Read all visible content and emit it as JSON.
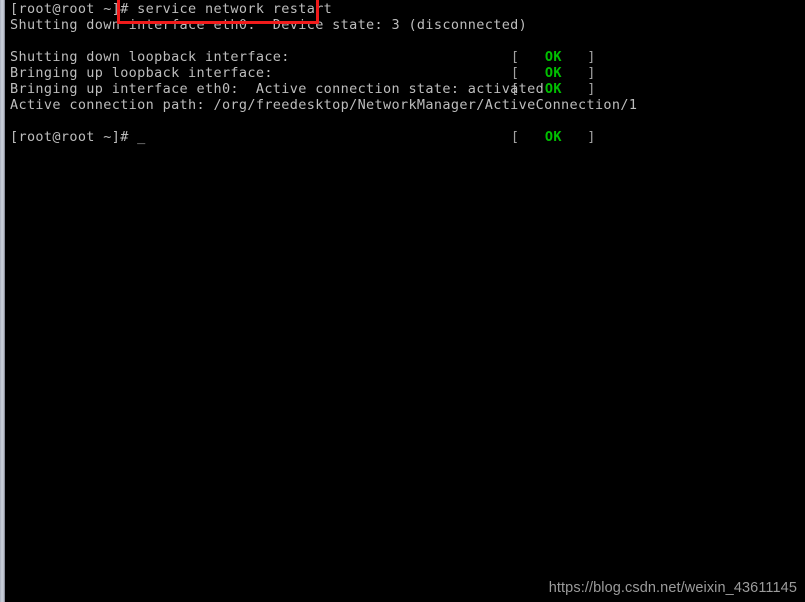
{
  "window": {
    "title": "terminal",
    "background_color": "#000000",
    "foreground_color": "#bdbdbd",
    "ok_color": "#00c000",
    "annotation_color": "#f01b1b"
  },
  "terminal": {
    "prompt": "[root@root ~]#",
    "command": "service network restart",
    "lines": [
      {
        "id": "line-1-prompt",
        "text": "[root@root ~]# service network restart"
      },
      {
        "id": "line-2-shutdown-eth0",
        "text": "Shutting down interface eth0:  Device state: 3 (disconnected)"
      },
      {
        "id": "line-3-ok-1",
        "text": ""
      },
      {
        "id": "line-4-shutdown-lo",
        "text": "Shutting down loopback interface:"
      },
      {
        "id": "line-5-bringup-lo",
        "text": "Bringing up loopback interface:"
      },
      {
        "id": "line-6-bringup-eth0",
        "text": "Bringing up interface eth0:  Active connection state: activated"
      },
      {
        "id": "line-7-conn-path",
        "text": "Active connection path: /org/freedesktop/NetworkManager/ActiveConnection/1"
      },
      {
        "id": "line-8-ok-4",
        "text": ""
      },
      {
        "id": "line-9-prompt",
        "text": "[root@root ~]# "
      }
    ],
    "status_markers": [
      {
        "id": "ok-marker-1",
        "open": "[",
        "label": "OK",
        "close": "]",
        "line": 3
      },
      {
        "id": "ok-marker-2",
        "open": "[",
        "label": "OK",
        "close": "]",
        "line": 4
      },
      {
        "id": "ok-marker-3",
        "open": "[",
        "label": "OK",
        "close": "]",
        "line": 5
      },
      {
        "id": "ok-marker-4",
        "open": "[",
        "label": "OK",
        "close": "]",
        "line": 8
      }
    ],
    "cursor": "_"
  },
  "annotation": {
    "type": "red-rectangle",
    "target_text": "service network restart"
  },
  "watermark": {
    "text": "https://blog.csdn.net/weixin_43611145"
  }
}
